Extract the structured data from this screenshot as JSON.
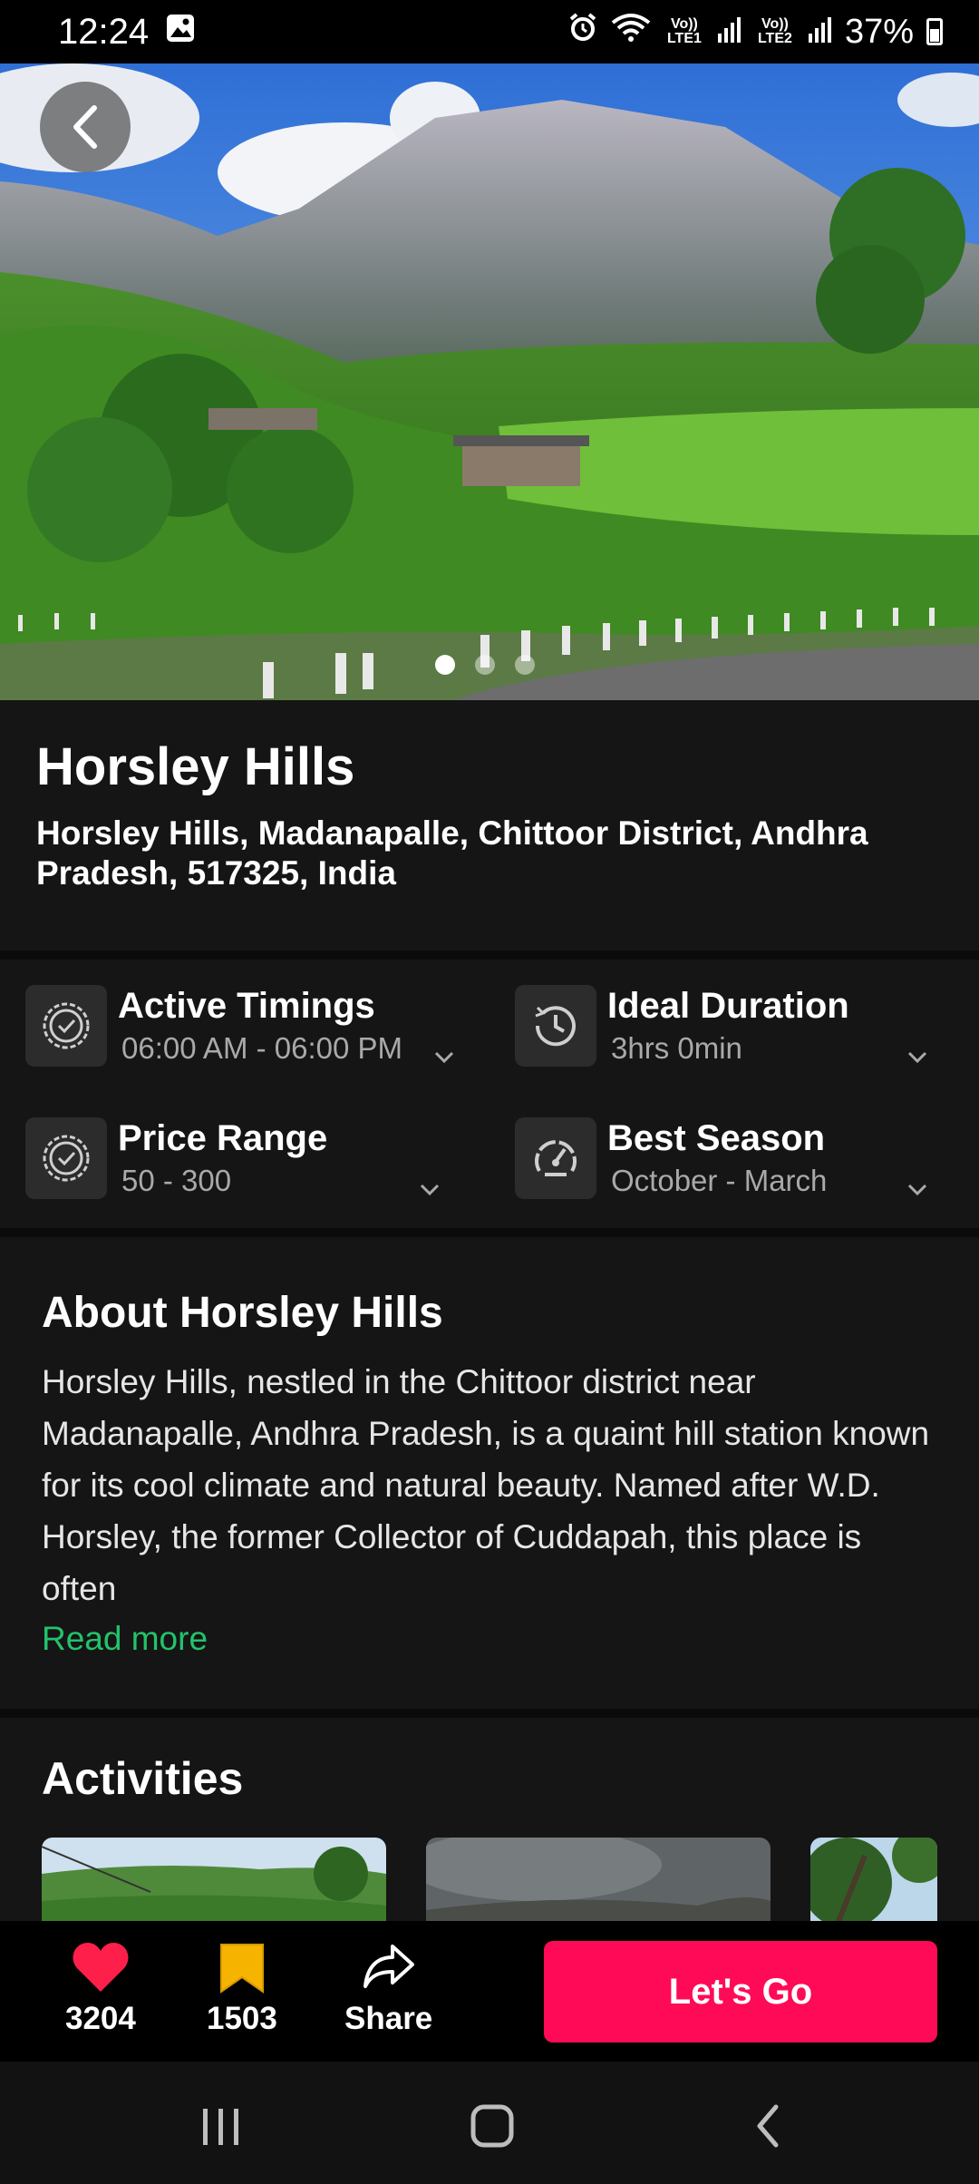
{
  "status_bar": {
    "time": "12:24",
    "lte1": "Vo)) LTE1",
    "lte2": "Vo)) LTE2",
    "battery": "37%"
  },
  "hero": {
    "carousel_count": 3,
    "active_index": 0
  },
  "place": {
    "name": "Horsley Hills",
    "address": "Horsley Hills, Madanapalle, Chittoor District, Andhra Pradesh, 517325, India"
  },
  "info": {
    "timings_title": "Active Timings",
    "timings_value": "06:00 AM - 06:00 PM",
    "duration_title": "Ideal Duration",
    "duration_value": "3hrs 0min",
    "price_title": "Price Range",
    "price_value": "50 - 300",
    "season_title": "Best Season",
    "season_value": "October - March"
  },
  "about": {
    "title": "About Horsley Hills",
    "text": "Horsley Hills, nestled in the Chittoor district near Madanapalle, Andhra Pradesh, is a quaint hill station known for its cool climate and natural beauty. Named after W.D. Horsley, the former Collector of Cuddapah, this place is often",
    "read_more": "Read more"
  },
  "activities": {
    "title": "Activities"
  },
  "actions": {
    "likes": "3204",
    "saves": "1503",
    "share": "Share",
    "go": "Let's Go"
  },
  "colors": {
    "accent": "#ff0a57",
    "link": "#23c36a",
    "like": "#ff1f4b",
    "bookmark": "#f6b400"
  }
}
